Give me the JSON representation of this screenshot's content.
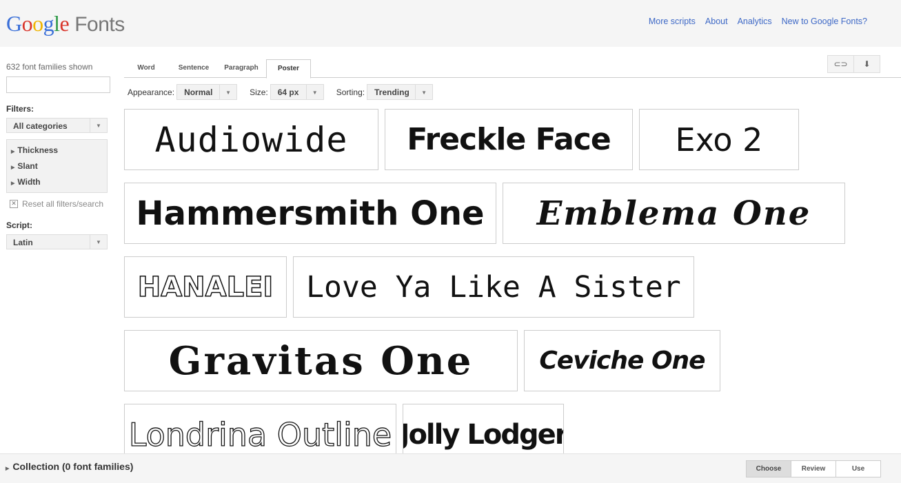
{
  "header": {
    "logo_letters": [
      "G",
      "o",
      "o",
      "g",
      "l",
      "e"
    ],
    "logo_suffix": "Fonts",
    "nav": [
      "More scripts",
      "About",
      "Analytics",
      "New to Google Fonts?"
    ]
  },
  "sidebar": {
    "count_text": "632 font families shown",
    "search_value": "",
    "filters_label": "Filters:",
    "category_value": "All categories",
    "filter_items": [
      "Thickness",
      "Slant",
      "Width"
    ],
    "reset_label": "Reset all filters/search",
    "script_label": "Script:",
    "script_value": "Latin"
  },
  "tabs": [
    "Word",
    "Sentence",
    "Paragraph",
    "Poster"
  ],
  "active_tab": "Poster",
  "controls": {
    "appearance_label": "Appearance:",
    "appearance_value": "Normal",
    "size_label": "Size:",
    "size_value": "64 px",
    "sorting_label": "Sorting:",
    "sorting_value": "Trending"
  },
  "fonts": [
    "Audiowide",
    "Freckle Face",
    "Exo 2",
    "Hammersmith One",
    "Emblema One",
    "HANALEI",
    "Love Ya Like A Sister",
    "Gravitas One",
    "Ceviche One",
    "Londrina Outline",
    "Jolly Lodger"
  ],
  "bottom": {
    "collection_label": "Collection (0 font families)",
    "steps": [
      "Choose",
      "Review",
      "Use"
    ],
    "active_step": "Choose"
  },
  "colors": {
    "link": "#3d68c6",
    "google_blue": "#3a6fd8",
    "google_red": "#d9352b",
    "google_yellow": "#f0b400",
    "google_green": "#2f9a48"
  },
  "icons": [
    "link-icon",
    "download-icon"
  ]
}
